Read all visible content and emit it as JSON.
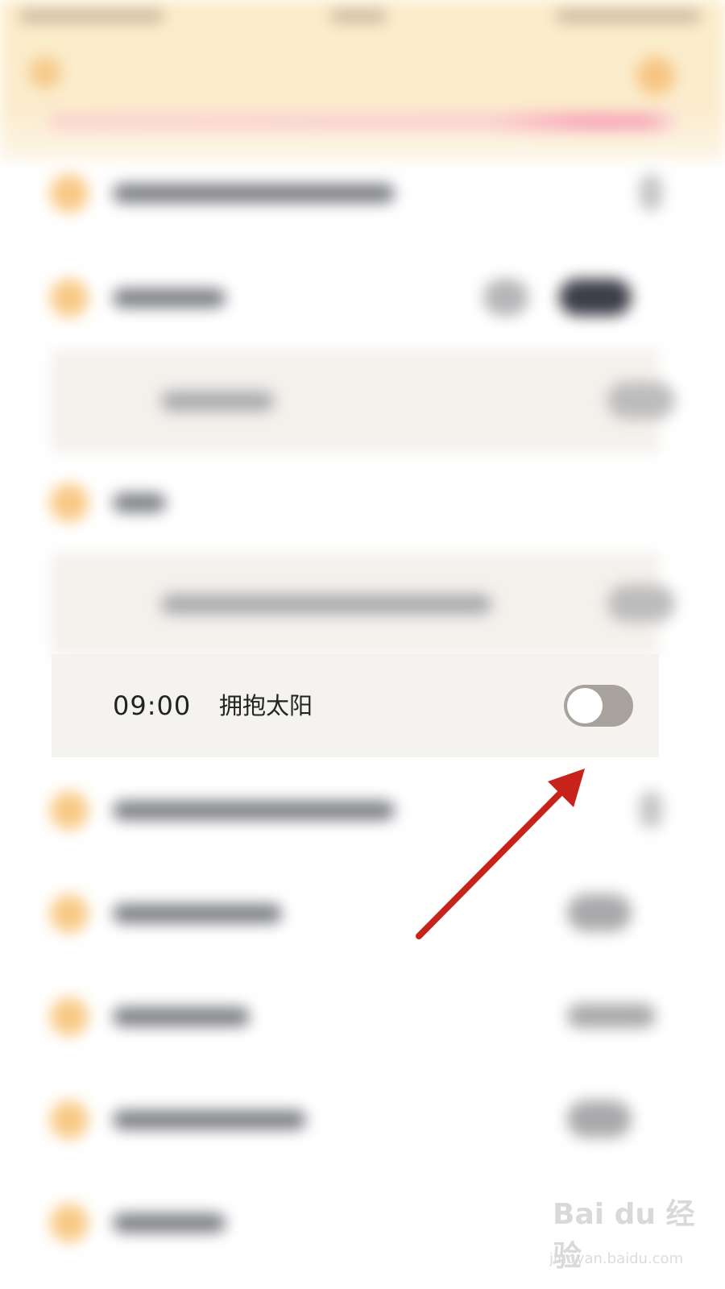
{
  "alarm_row": {
    "time": "09:00",
    "label": "拥抱太阳",
    "toggle_on": false
  },
  "colors": {
    "header": "#fbecc9",
    "accent_orange": "#f8c985",
    "toggle_off": "#a7a29c",
    "annotation_arrow": "#c8231b"
  },
  "watermark": {
    "logo": "Bai du 经验",
    "url": "jingyan.baidu.com"
  }
}
